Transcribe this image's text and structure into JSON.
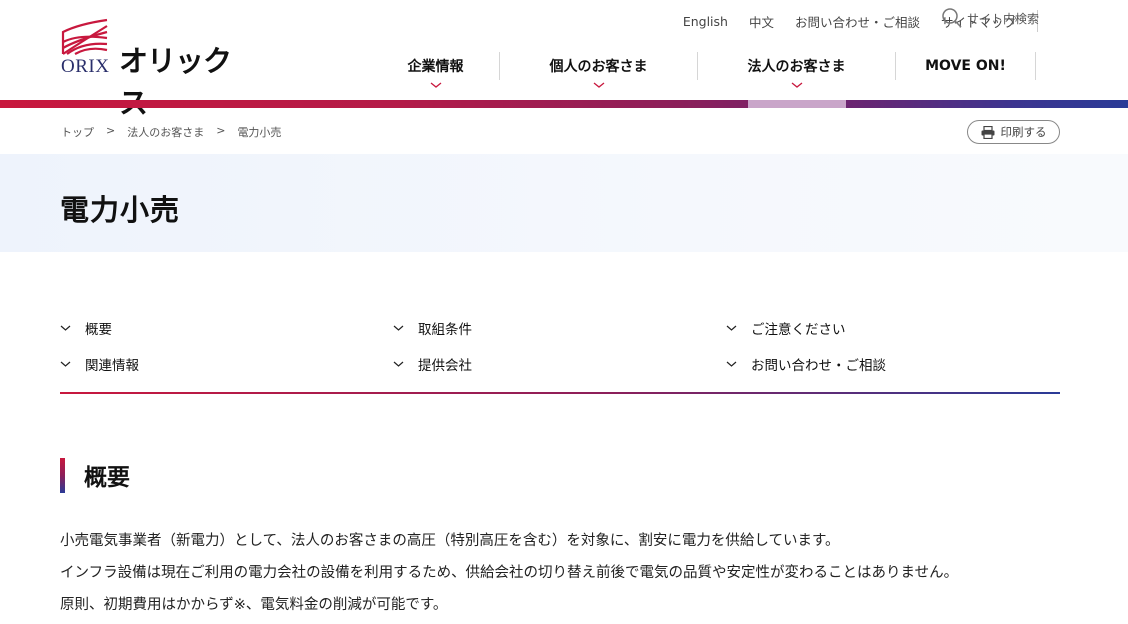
{
  "brand": {
    "latin": "ORIX",
    "kana": "オリックス",
    "colors": {
      "red": "#c8183e",
      "navy": "#2a3b97",
      "purple": "#8c1f5a"
    }
  },
  "utility_nav": {
    "links": [
      "English",
      "中文",
      "お問い合わせ・ご相談",
      "サイトマップ"
    ],
    "search_label": "サイト内検索"
  },
  "main_nav": {
    "items": [
      {
        "label": "企業情報",
        "has_dropdown": true
      },
      {
        "label": "個人のお客さま",
        "has_dropdown": true
      },
      {
        "label": "法人のお客さま",
        "has_dropdown": true,
        "active": true
      },
      {
        "label": "MOVE ON!",
        "has_dropdown": false
      }
    ]
  },
  "breadcrumb": {
    "items": [
      "トップ",
      "法人のお客さま",
      "電力小売"
    ],
    "separator": ">"
  },
  "print_button": {
    "label": "印刷する",
    "icon": "printer-icon"
  },
  "page": {
    "title": "電力小売"
  },
  "anchor_nav": {
    "items": [
      "概要",
      "取組条件",
      "ご注意ください",
      "関連情報",
      "提供会社",
      "お問い合わせ・ご相談"
    ]
  },
  "section": {
    "title": "概要",
    "paragraphs": [
      "小売電気事業者（新電力）として、法人のお客さまの高圧（特別高圧を含む）を対象に、割安に電力を供給しています。",
      "インフラ設備は現在ご利用の電力会社の設備を利用するため、供給会社の切り替え前後で電気の品質や安定性が変わることはありません。",
      "原則、初期費用はかからず※、電気料金の削減が可能です。"
    ]
  }
}
